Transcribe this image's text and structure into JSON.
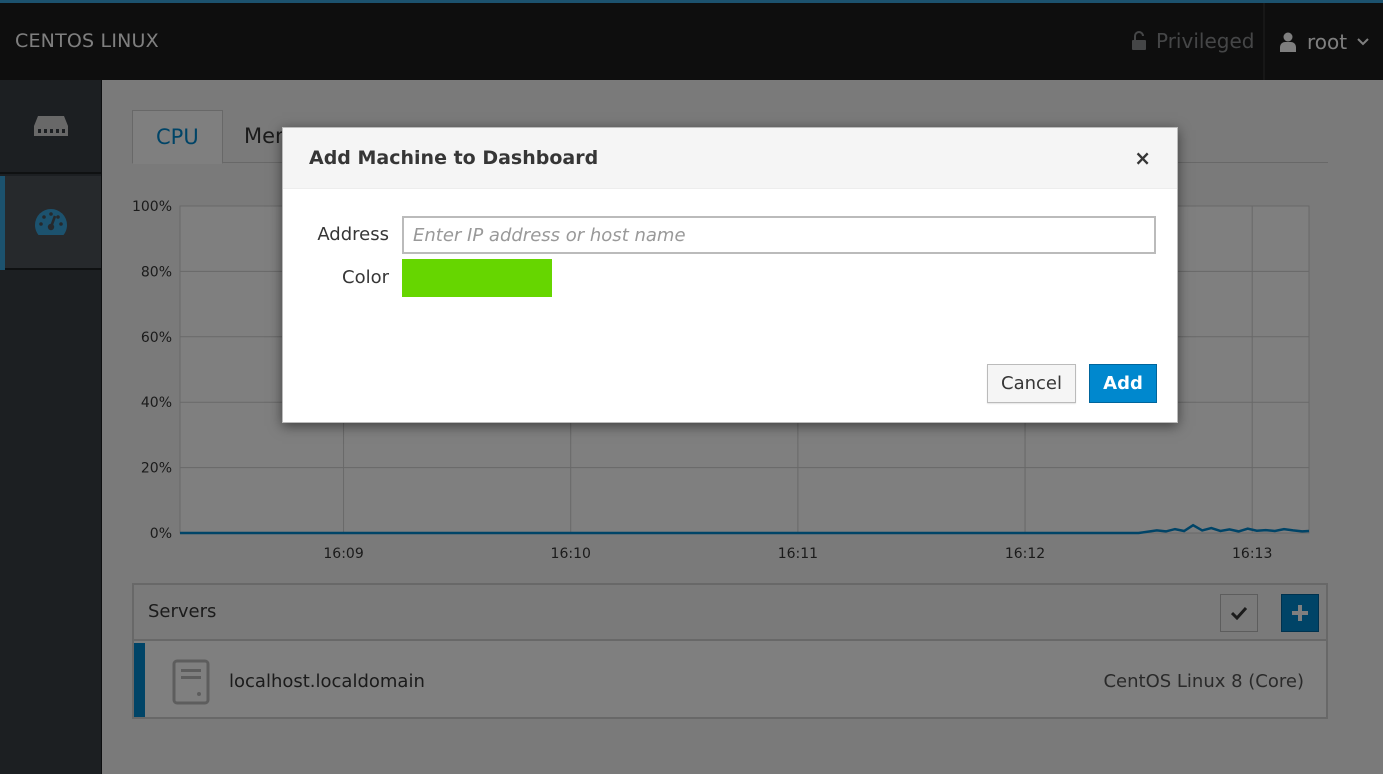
{
  "topbar": {
    "brand": "CENTOS LINUX",
    "privileged_label": "Privileged",
    "user_label": "root"
  },
  "sidebar": {
    "items": [
      {
        "name": "hosts",
        "icon": "server-rack-icon"
      },
      {
        "name": "dashboard",
        "icon": "dashboard-gauge-icon",
        "active": true
      }
    ]
  },
  "tabs": [
    {
      "label": "CPU",
      "active": true
    },
    {
      "label": "Mem"
    }
  ],
  "chart_data": {
    "type": "line",
    "y_ticks": [
      "100%",
      "80%",
      "60%",
      "40%",
      "20%",
      "0%"
    ],
    "x_ticks": [
      "16:09",
      "16:10",
      "16:11",
      "16:12",
      "16:13"
    ],
    "ylim": [
      0,
      100
    ],
    "series": [
      {
        "color": "#0088ce",
        "x_minutes": [
          8.28,
          8.5,
          9,
          9.5,
          10,
          10.5,
          11,
          11.5,
          12,
          12.5,
          12.58,
          12.62,
          12.66,
          12.7,
          12.74,
          12.78,
          12.82,
          12.86,
          12.9,
          12.94,
          12.98,
          13.02,
          13.06,
          13.1,
          13.14,
          13.18,
          13.22,
          13.25
        ],
        "values": [
          0,
          0,
          0,
          0,
          0,
          0,
          0,
          0,
          0,
          0,
          0.8,
          0.5,
          1.2,
          0.6,
          2.4,
          0.8,
          1.5,
          0.6,
          1.1,
          0.5,
          1.3,
          0.7,
          0.9,
          0.6,
          1.2,
          0.8,
          0.5,
          0.6
        ]
      }
    ]
  },
  "servers": {
    "title": "Servers",
    "rows": [
      {
        "name": "localhost.localdomain",
        "os": "CentOS Linux 8 (Core)",
        "color": "#0088ce"
      }
    ]
  },
  "modal": {
    "title": "Add Machine to Dashboard",
    "close_glyph": "×",
    "address_label": "Address",
    "address_value": "",
    "address_placeholder": "Enter IP address or host name",
    "color_label": "Color",
    "color_value": "#66d600",
    "cancel_label": "Cancel",
    "add_label": "Add"
  }
}
